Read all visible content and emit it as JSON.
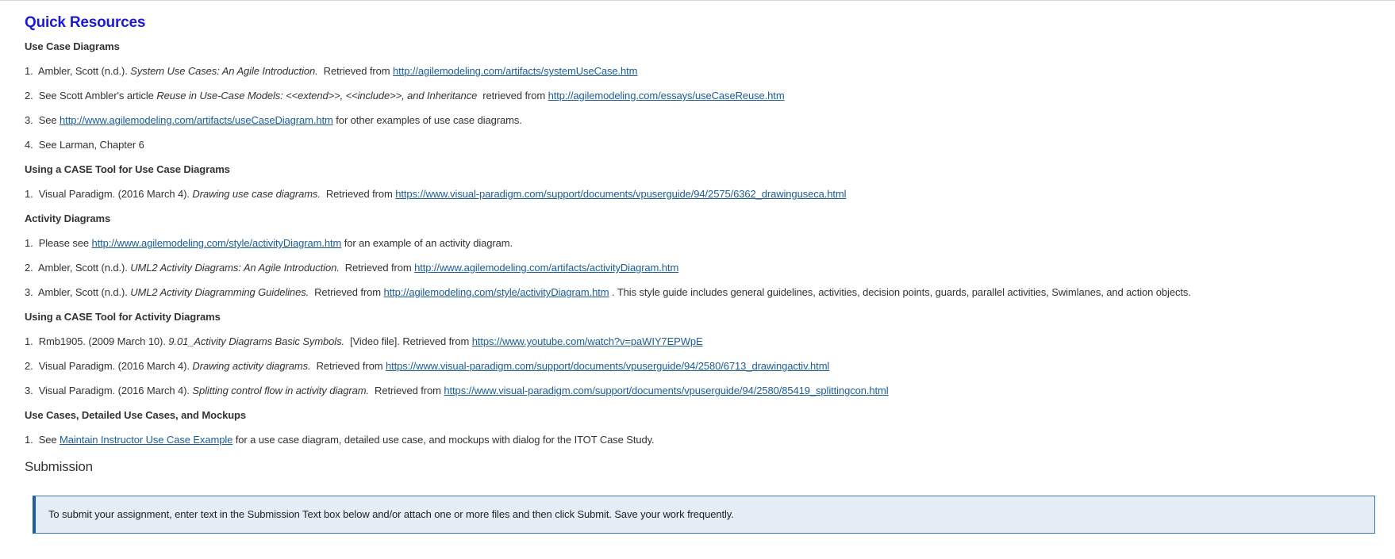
{
  "quick_resources": {
    "title": "Quick Resources",
    "sections": [
      {
        "heading": "Use Case Diagrams",
        "items": [
          {
            "num": "1.",
            "pre": "Ambler, Scott (n.d.).",
            "title": "System Use Cases: An Agile Introduction.",
            "mid": "Retrieved from",
            "link": "http://agilemodeling.com/artifacts/systemUseCase.htm",
            "post": ""
          },
          {
            "num": "2.",
            "pre": "See Scott Ambler's article",
            "title": "Reuse in Use-Case Models: <<extend>>, <<include>>, and Inheritance",
            "mid": "retrieved from",
            "link": "http://agilemodeling.com/essays/useCaseReuse.htm",
            "post": ""
          },
          {
            "num": "3.",
            "pre": "See",
            "title": "",
            "mid": "",
            "link": "http://www.agilemodeling.com/artifacts/useCaseDiagram.htm",
            "post": "for other examples of use case diagrams."
          },
          {
            "num": "4.",
            "pre": "See  Larman, Chapter 6",
            "title": "",
            "mid": "",
            "link": "",
            "post": ""
          }
        ]
      },
      {
        "heading": "Using a CASE Tool for Use Case Diagrams",
        "items": [
          {
            "num": "1.",
            "pre": "Visual Paradigm. (2016 March 4).",
            "title": "Drawing use case diagrams.",
            "mid": "Retrieved from",
            "link": "https://www.visual-paradigm.com/support/documents/vpuserguide/94/2575/6362_drawinguseca.html",
            "post": ""
          }
        ]
      },
      {
        "heading": "Activity Diagrams",
        "items": [
          {
            "num": "1.",
            "pre": "Please see",
            "title": "",
            "mid": "",
            "link": "http://www.agilemodeling.com/style/activityDiagram.htm",
            "post": "for an example of an activity diagram."
          },
          {
            "num": "2.",
            "pre": "Ambler, Scott (n.d.).",
            "title": "UML2 Activity Diagrams: An Agile Introduction.",
            "mid": "Retrieved from",
            "link": "http://www.agilemodeling.com/artifacts/activityDiagram.htm",
            "post": ""
          },
          {
            "num": "3.",
            "pre": "Ambler, Scott (n.d.).",
            "title": "UML2 Activity Diagramming Guidelines.",
            "mid": "Retrieved from",
            "link": "http://agilemodeling.com/style/activityDiagram.htm",
            "post": ".  This style guide includes general guidelines, activities, decision points, guards, parallel activities, Swimlanes, and action objects."
          }
        ]
      },
      {
        "heading": "Using a CASE Tool for Activity Diagrams",
        "items": [
          {
            "num": "1.",
            "pre": "Rmb1905. (2009 March 10).",
            "title": "9.01_Activity Diagrams Basic Symbols.",
            "mid": "[Video file].  Retrieved from",
            "link": "https://www.youtube.com/watch?v=paWIY7EPWpE",
            "post": ""
          },
          {
            "num": "2.",
            "pre": "Visual Paradigm. (2016 March 4).",
            "title": "Drawing activity diagrams.",
            "mid": "Retrieved from",
            "link": "https://www.visual-paradigm.com/support/documents/vpuserguide/94/2580/6713_drawingactiv.html",
            "post": ""
          },
          {
            "num": "3.",
            "pre": "Visual Paradigm. (2016 March 4).",
            "title": "Splitting control flow in activity diagram.",
            "mid": "Retrieved from",
            "link": "https://www.visual-paradigm.com/support/documents/vpuserguide/94/2580/85419_splittingcon.html",
            "post": ""
          }
        ]
      },
      {
        "heading": "Use Cases, Detailed Use Cases, and Mockups",
        "items": [
          {
            "num": "1.",
            "pre": "See ",
            "title": "",
            "mid": "",
            "link": "Maintain Instructor Use Case Example",
            "post": "for a use case diagram, detailed use case, and mockups with dialog for the ITOT Case Study."
          }
        ]
      }
    ]
  },
  "submission": {
    "title": "Submission",
    "notice": "To submit your assignment, enter text in the Submission Text box below and/or attach one or more files and then click Submit. Save your work frequently."
  },
  "colors": {
    "title_blue": "#1a1ad6",
    "link_blue": "#1a5c99",
    "notice_bg": "#e5eef6",
    "notice_border": "#1d5f9c"
  }
}
